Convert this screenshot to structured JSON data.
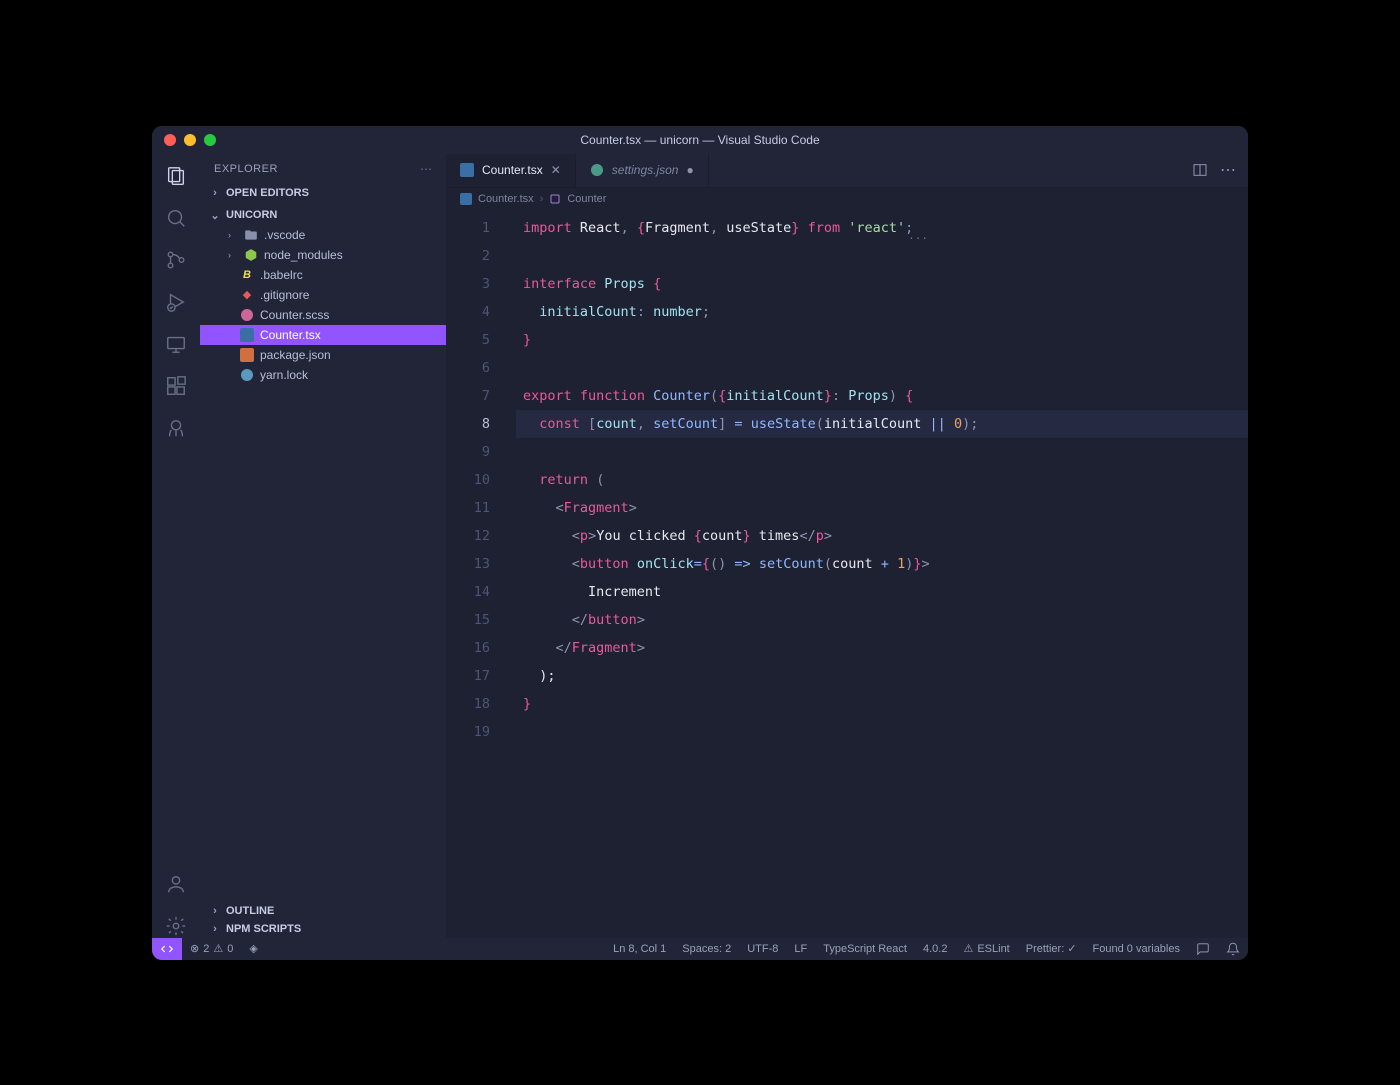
{
  "window": {
    "title": "Counter.tsx — unicorn — Visual Studio Code"
  },
  "sidebar": {
    "title": "EXPLORER",
    "openEditors": "OPEN EDITORS",
    "project": "UNICORN",
    "tree": [
      {
        "label": ".vscode",
        "type": "folder"
      },
      {
        "label": "node_modules",
        "type": "folder"
      },
      {
        "label": ".babelrc",
        "type": "babel"
      },
      {
        "label": ".gitignore",
        "type": "git"
      },
      {
        "label": "Counter.scss",
        "type": "scss"
      },
      {
        "label": "Counter.tsx",
        "type": "tsx",
        "selected": true
      },
      {
        "label": "package.json",
        "type": "json"
      },
      {
        "label": "yarn.lock",
        "type": "yarn"
      }
    ],
    "outline": "OUTLINE",
    "npmScripts": "NPM SCRIPTS"
  },
  "tabs": {
    "items": [
      {
        "label": "Counter.tsx",
        "icon": "tsx",
        "active": true,
        "close": true
      },
      {
        "label": "settings.json",
        "icon": "json",
        "active": false,
        "close": false,
        "dirty": true
      }
    ]
  },
  "breadcrumb": {
    "file": "Counter.tsx",
    "symbol": "Counter"
  },
  "editor": {
    "currentLine": 8,
    "hint": "...",
    "lines": [
      {
        "n": 1,
        "tokens": [
          [
            "kw",
            "import"
          ],
          [
            "var",
            " React"
          ],
          [
            "pun",
            ", "
          ],
          [
            "brace",
            "{"
          ],
          [
            "var",
            "Fragment"
          ],
          [
            "pun",
            ", "
          ],
          [
            "var",
            "useState"
          ],
          [
            "brace",
            "}"
          ],
          [
            "var",
            " "
          ],
          [
            "kw",
            "from"
          ],
          [
            "var",
            " "
          ],
          [
            "str",
            "'react'"
          ],
          [
            "pun",
            ";"
          ]
        ]
      },
      {
        "n": 2,
        "tokens": []
      },
      {
        "n": 3,
        "tokens": [
          [
            "kw",
            "interface"
          ],
          [
            "var",
            " "
          ],
          [
            "type",
            "Props"
          ],
          [
            "var",
            " "
          ],
          [
            "brace",
            "{"
          ]
        ]
      },
      {
        "n": 4,
        "tokens": [
          [
            "var",
            "  "
          ],
          [
            "prop",
            "initialCount"
          ],
          [
            "pun",
            ": "
          ],
          [
            "type",
            "number"
          ],
          [
            "pun",
            ";"
          ]
        ]
      },
      {
        "n": 5,
        "tokens": [
          [
            "brace",
            "}"
          ]
        ]
      },
      {
        "n": 6,
        "tokens": []
      },
      {
        "n": 7,
        "tokens": [
          [
            "kw",
            "export"
          ],
          [
            "var",
            " "
          ],
          [
            "kw",
            "function"
          ],
          [
            "var",
            " "
          ],
          [
            "fn",
            "Counter"
          ],
          [
            "pun",
            "("
          ],
          [
            "brace",
            "{"
          ],
          [
            "prop",
            "initialCount"
          ],
          [
            "brace",
            "}"
          ],
          [
            "pun",
            ": "
          ],
          [
            "type",
            "Props"
          ],
          [
            "pun",
            ")"
          ],
          [
            "var",
            " "
          ],
          [
            "brace",
            "{"
          ]
        ]
      },
      {
        "n": 8,
        "tokens": [
          [
            "var",
            "  "
          ],
          [
            "kw",
            "const"
          ],
          [
            "var",
            " "
          ],
          [
            "pun",
            "["
          ],
          [
            "prop",
            "count"
          ],
          [
            "pun",
            ", "
          ],
          [
            "fn",
            "setCount"
          ],
          [
            "pun",
            "]"
          ],
          [
            "var",
            " "
          ],
          [
            "op",
            "="
          ],
          [
            "var",
            " "
          ],
          [
            "fn",
            "useState"
          ],
          [
            "pun",
            "("
          ],
          [
            "var",
            "initialCount "
          ],
          [
            "op",
            "||"
          ],
          [
            "var",
            " "
          ],
          [
            "num",
            "0"
          ],
          [
            "pun",
            ");"
          ]
        ]
      },
      {
        "n": 9,
        "tokens": []
      },
      {
        "n": 10,
        "tokens": [
          [
            "var",
            "  "
          ],
          [
            "kw",
            "return"
          ],
          [
            "var",
            " "
          ],
          [
            "pun",
            "("
          ]
        ]
      },
      {
        "n": 11,
        "tokens": [
          [
            "var",
            "    "
          ],
          [
            "pun",
            "<"
          ],
          [
            "tag",
            "Fragment"
          ],
          [
            "pun",
            ">"
          ]
        ]
      },
      {
        "n": 12,
        "tokens": [
          [
            "var",
            "      "
          ],
          [
            "pun",
            "<"
          ],
          [
            "tag",
            "p"
          ],
          [
            "pun",
            ">"
          ],
          [
            "var",
            "You clicked "
          ],
          [
            "brace",
            "{"
          ],
          [
            "var",
            "count"
          ],
          [
            "brace",
            "}"
          ],
          [
            "var",
            " times"
          ],
          [
            "pun",
            "</"
          ],
          [
            "tag",
            "p"
          ],
          [
            "pun",
            ">"
          ]
        ]
      },
      {
        "n": 13,
        "tokens": [
          [
            "var",
            "      "
          ],
          [
            "pun",
            "<"
          ],
          [
            "tag",
            "button"
          ],
          [
            "var",
            " "
          ],
          [
            "attr",
            "onClick"
          ],
          [
            "op",
            "="
          ],
          [
            "brace",
            "{"
          ],
          [
            "pun",
            "() "
          ],
          [
            "op",
            "=>"
          ],
          [
            "var",
            " "
          ],
          [
            "fn",
            "setCount"
          ],
          [
            "pun",
            "("
          ],
          [
            "var",
            "count "
          ],
          [
            "op",
            "+"
          ],
          [
            "var",
            " "
          ],
          [
            "num",
            "1"
          ],
          [
            "pun",
            ")"
          ],
          [
            "brace",
            "}"
          ],
          [
            "pun",
            ">"
          ]
        ]
      },
      {
        "n": 14,
        "tokens": [
          [
            "var",
            "        Increment"
          ]
        ]
      },
      {
        "n": 15,
        "tokens": [
          [
            "var",
            "      "
          ],
          [
            "pun",
            "</"
          ],
          [
            "tag",
            "button"
          ],
          [
            "pun",
            ">"
          ]
        ]
      },
      {
        "n": 16,
        "tokens": [
          [
            "var",
            "    "
          ],
          [
            "pun",
            "</"
          ],
          [
            "tag",
            "Fragment"
          ],
          [
            "pun",
            ">"
          ]
        ]
      },
      {
        "n": 17,
        "tokens": [
          [
            "var",
            "  );"
          ]
        ]
      },
      {
        "n": 18,
        "tokens": [
          [
            "brace",
            "}"
          ]
        ]
      },
      {
        "n": 19,
        "tokens": []
      }
    ]
  },
  "status": {
    "errors": "2",
    "warnings": "0",
    "cursor": "Ln 8, Col 1",
    "spaces": "Spaces: 2",
    "encoding": "UTF-8",
    "eol": "LF",
    "lang": "TypeScript React",
    "version": "4.0.2",
    "eslint": "ESLint",
    "prettier": "Prettier: ✓",
    "variables": "Found 0 variables"
  }
}
